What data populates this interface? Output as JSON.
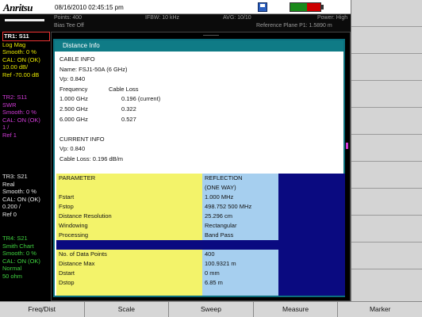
{
  "header": {
    "logo": "Anritsu",
    "datetime": "08/16/2010 02:45:15 pm",
    "battery_level": 0.55
  },
  "status": {
    "points": "Points: 400",
    "bias_tee": "Bias Tee Off",
    "ifbw": "IFBW: 10 kHz",
    "avg": "AVG: 10/10",
    "power": "Power: High",
    "reference_plane": "Reference Plane P1: 1.5890 m"
  },
  "traces": {
    "tr1": {
      "title": "TR1: S11",
      "lines": [
        "Log Mag",
        "Smooth: 0 %",
        "CAL: ON (OK)",
        "10.00 dB/",
        "Ref -70.00 dB"
      ]
    },
    "tr2": {
      "title": "TR2: S11",
      "lines": [
        "SWR",
        "Smooth: 0 %",
        "CAL: ON (OK)",
        "1 /",
        "Ref 1"
      ]
    },
    "tr3": {
      "title": "TR3: S21",
      "lines": [
        "Real",
        "Smooth: 0 %",
        "CAL: ON (OK)",
        "0.200 /",
        "Ref 0"
      ]
    },
    "tr4": {
      "title": "TR4: S21",
      "lines": [
        "Smith Chart",
        "Smooth: 0 %",
        "CAL: ON (OK)",
        "Normal",
        "50 ohm"
      ]
    }
  },
  "dialog": {
    "title": "Distance Info",
    "cable_info_heading": "CABLE INFO",
    "cable_name": "Name: FSJ1-50A (6 GHz)",
    "cable_vp": "Vp: 0.840",
    "freq_header": "Frequency",
    "loss_header": "Cable Loss",
    "loss_rows": [
      {
        "freq": "1.000 GHz",
        "loss": "0.196 (current)"
      },
      {
        "freq": "2.500 GHz",
        "loss": "0.322"
      },
      {
        "freq": "6.000 GHz",
        "loss": "0.527"
      }
    ],
    "current_info_heading": "CURRENT INFO",
    "current_vp": "Vp: 0.840",
    "current_loss": "Cable Loss: 0.196 dB/m",
    "param_header": "PARAMETER",
    "value_header": "REFLECTION",
    "value_subheader": "(ONE WAY)",
    "params_top": [
      {
        "name": "Fstart",
        "value": "1.000 MHz"
      },
      {
        "name": "Fstop",
        "value": "498.752 500 MHz"
      },
      {
        "name": "Distance Resolution",
        "value": "25.296 cm"
      },
      {
        "name": "Windowing",
        "value": "Rectangular"
      },
      {
        "name": "Processing",
        "value": "Band Pass"
      }
    ],
    "params_bottom": [
      {
        "name": "No. of Data Points",
        "value": "400"
      },
      {
        "name": "Distance Max",
        "value": "100.9321 m"
      },
      {
        "name": "Dstart",
        "value": "0 mm"
      },
      {
        "name": "Dstop",
        "value": "6.85 m"
      }
    ]
  },
  "menu": [
    "Freq/Dist",
    "Scale",
    "Sweep",
    "Measure",
    "Marker"
  ]
}
